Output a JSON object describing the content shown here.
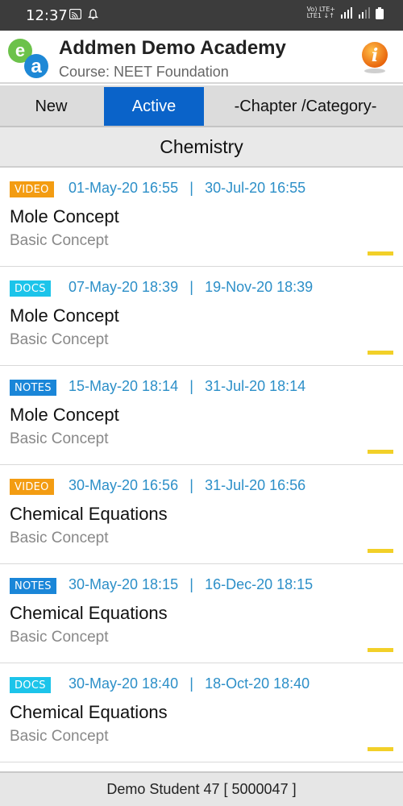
{
  "status_bar": {
    "time": "12:37",
    "network_top": "Vo) LTE+",
    "network_bottom": "LTE1 ↓↑",
    "icons": [
      "cast-icon",
      "notification-bell-icon",
      "signal-icon",
      "signal-icon",
      "battery-icon"
    ]
  },
  "header": {
    "title": "Addmen Demo Academy",
    "subtitle": "Course: NEET Foundation",
    "logo_icon": "ea-logo",
    "info_icon": "info-icon"
  },
  "tabs": [
    {
      "label": "New",
      "active": false
    },
    {
      "label": "Active",
      "active": true
    },
    {
      "label": "-Chapter /Category-",
      "active": false
    }
  ],
  "subject": "Chemistry",
  "colors": {
    "accent": "#0a63c9",
    "video_badge": "#f39c12",
    "docs_badge": "#1cc4ea",
    "notes_badge": "#1a86d8",
    "date_text": "#2c8fc8",
    "progress": "#f2d028"
  },
  "items": [
    {
      "type": "VIDEO",
      "start": "01-May-20 16:55",
      "end": "30-Jul-20 16:55",
      "title": "Mole Concept",
      "subtitle": "Basic Concept"
    },
    {
      "type": "DOCS",
      "start": "07-May-20 18:39",
      "end": "19-Nov-20 18:39",
      "title": "Mole Concept",
      "subtitle": "Basic Concept"
    },
    {
      "type": "NOTES",
      "start": "15-May-20 18:14",
      "end": "31-Jul-20 18:14",
      "title": "Mole Concept",
      "subtitle": "Basic Concept"
    },
    {
      "type": "VIDEO",
      "start": "30-May-20 16:56",
      "end": "31-Jul-20 16:56",
      "title": "Chemical Equations",
      "subtitle": "Basic Concept"
    },
    {
      "type": "NOTES",
      "start": "30-May-20 18:15",
      "end": "16-Dec-20 18:15",
      "title": "Chemical Equations",
      "subtitle": "Basic Concept"
    },
    {
      "type": "DOCS",
      "start": "30-May-20 18:40",
      "end": "18-Oct-20 18:40",
      "title": "Chemical Equations",
      "subtitle": "Basic Concept"
    }
  ],
  "date_separator": "|",
  "footer": "Demo Student 47 [ 5000047 ]"
}
